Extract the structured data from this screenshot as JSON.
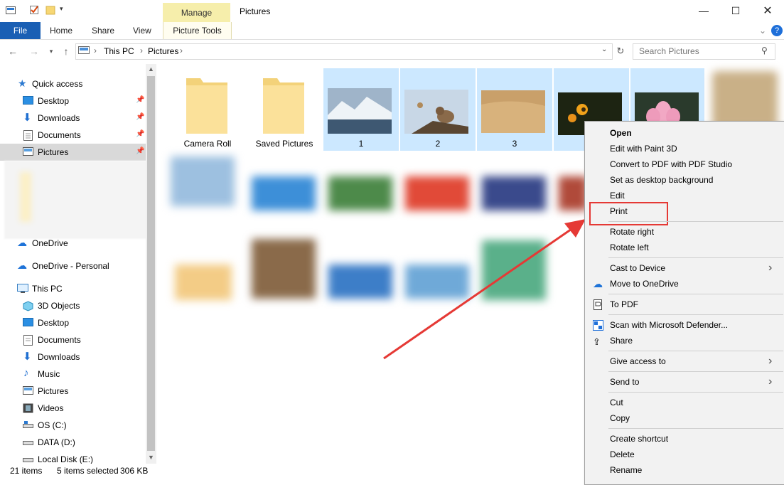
{
  "window": {
    "title": "Pictures",
    "contextual_group": "Manage",
    "minimize_icon": "minimize-icon",
    "maximize_icon": "maximize-icon",
    "close_icon": "close-icon"
  },
  "ribbon": {
    "tabs": [
      "File",
      "Home",
      "Share",
      "View",
      "Picture Tools"
    ],
    "help_icon": "help-icon"
  },
  "address": {
    "breadcrumb": [
      "This PC",
      "Pictures"
    ],
    "search_placeholder": "Search Pictures"
  },
  "nav": {
    "quick_access": "Quick access",
    "quick_items": [
      "Desktop",
      "Downloads",
      "Documents",
      "Pictures"
    ],
    "onedrive": "OneDrive",
    "onedrive_personal": "OneDrive - Personal",
    "this_pc": "This PC",
    "pc_items": [
      "3D Objects",
      "Desktop",
      "Documents",
      "Downloads",
      "Music",
      "Pictures",
      "Videos",
      "OS (C:)",
      "DATA (D:)",
      "Local Disk (E:)"
    ]
  },
  "files": [
    {
      "name": "Camera Roll",
      "kind": "folder",
      "selected": false
    },
    {
      "name": "Saved Pictures",
      "kind": "folder",
      "selected": false
    },
    {
      "name": "1",
      "kind": "image",
      "selected": true
    },
    {
      "name": "2",
      "kind": "image",
      "selected": true
    },
    {
      "name": "3",
      "kind": "image",
      "selected": true
    },
    {
      "name": "",
      "kind": "image",
      "selected": true
    },
    {
      "name": "",
      "kind": "image",
      "selected": true
    }
  ],
  "context_menu": {
    "items": [
      "Open",
      "Edit with Paint 3D",
      "Convert to PDF with PDF Studio",
      "Set as desktop background",
      "Edit",
      "Print",
      "Rotate right",
      "Rotate left",
      "Cast to Device",
      "Move to OneDrive",
      "To PDF",
      "Scan with Microsoft Defender...",
      "Share",
      "Give access to",
      "Send to",
      "Cut",
      "Copy",
      "Create shortcut",
      "Delete",
      "Rename"
    ],
    "highlighted": "Print"
  },
  "status": {
    "count": "21 items",
    "selection": "5 items selected",
    "size": "306 KB"
  },
  "colors": {
    "file_tab": "#1a5fb4",
    "manage_tab": "#f6eeab",
    "selection": "#cce8ff",
    "annotation": "#e53935"
  }
}
